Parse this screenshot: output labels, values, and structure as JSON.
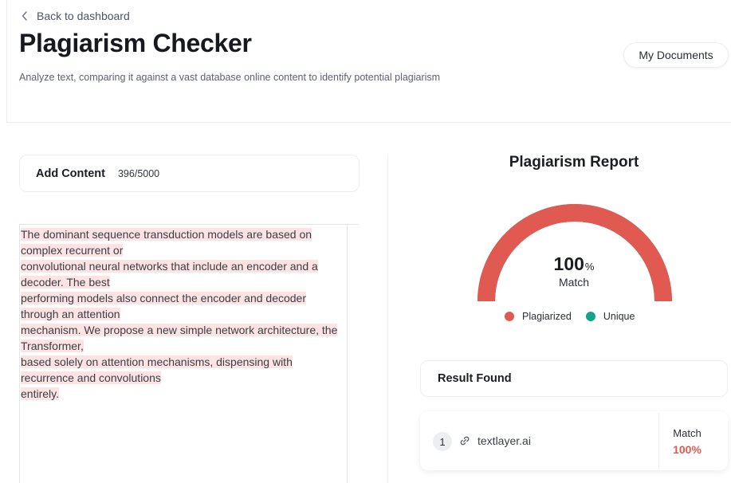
{
  "header": {
    "back_label": "Back to dashboard",
    "title": "Plagiarism Checker",
    "subtitle": "Analyze text, comparing it against a vast database online content to identify potential plagiarism",
    "my_documents_label": "My Documents"
  },
  "editor": {
    "title": "Add Content",
    "char_count": "396/5000",
    "lines": [
      "The dominant sequence transduction models are based on complex recurrent or",
      "convolutional neural networks that include an encoder and a decoder. The best",
      "performing models also connect the encoder and decoder through an attention",
      "mechanism. We propose a new simple network architecture, the Transformer,",
      "based solely on attention mechanisms, dispensing with recurrence and convolutions",
      "entirely."
    ]
  },
  "report": {
    "title": "Plagiarism Report",
    "gauge_value": "100",
    "gauge_unit": "%",
    "gauge_label": "Match",
    "plagiarized_fraction": 1.0,
    "legend": [
      {
        "label": "Plagiarized",
        "color": "#e05a52"
      },
      {
        "label": "Unique",
        "color": "#14a38b"
      }
    ]
  },
  "results": {
    "title": "Result Found",
    "items": [
      {
        "index": "1",
        "domain": "textlayer.ai",
        "match_label": "Match",
        "match_value": "100%"
      }
    ]
  },
  "colors": {
    "accent_red": "#e05a52",
    "accent_teal": "#14a38b",
    "highlight": "#fde3e3"
  },
  "icons": {
    "back": "chevron-left-icon",
    "link": "link-icon"
  }
}
